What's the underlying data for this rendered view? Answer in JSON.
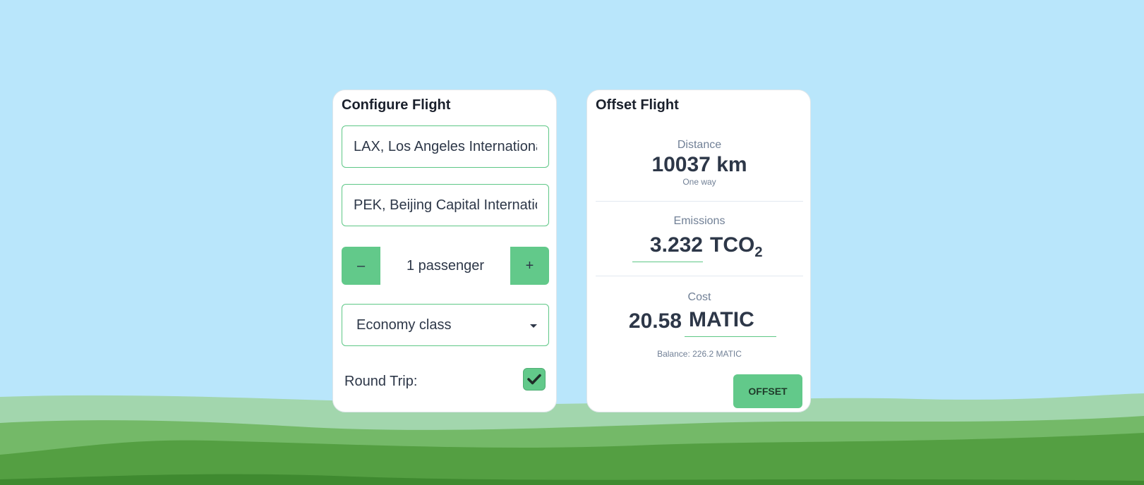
{
  "configure": {
    "title": "Configure Flight",
    "origin_value": "LAX, Los Angeles International Airport",
    "destination_value": "PEK, Beijing Capital International Airport",
    "decrement_label": "–",
    "passengers_label": "1 passenger",
    "increment_label": "+",
    "class_selected": "Economy class",
    "round_trip_label": "Round Trip:",
    "round_trip_checked": true
  },
  "offset": {
    "title": "Offset Flight",
    "distance_label": "Distance",
    "distance_value": "10037 km",
    "distance_sub": "One way",
    "emissions_label": "Emissions",
    "emissions_value": "3.232",
    "emissions_unit": "TCO",
    "emissions_unit_sub": "2",
    "cost_label": "Cost",
    "cost_value": "20.58",
    "cost_unit": "MATIC",
    "balance": "Balance: 226.2 MATIC",
    "offset_button": "OFFSET"
  },
  "colors": {
    "sky": "#b9e6fb",
    "accent": "#62c98a",
    "hill_light": "#a2d6ad",
    "hill_mid": "#74b968",
    "hill_dark": "#549f42",
    "hill_darkest": "#3f8a30"
  }
}
